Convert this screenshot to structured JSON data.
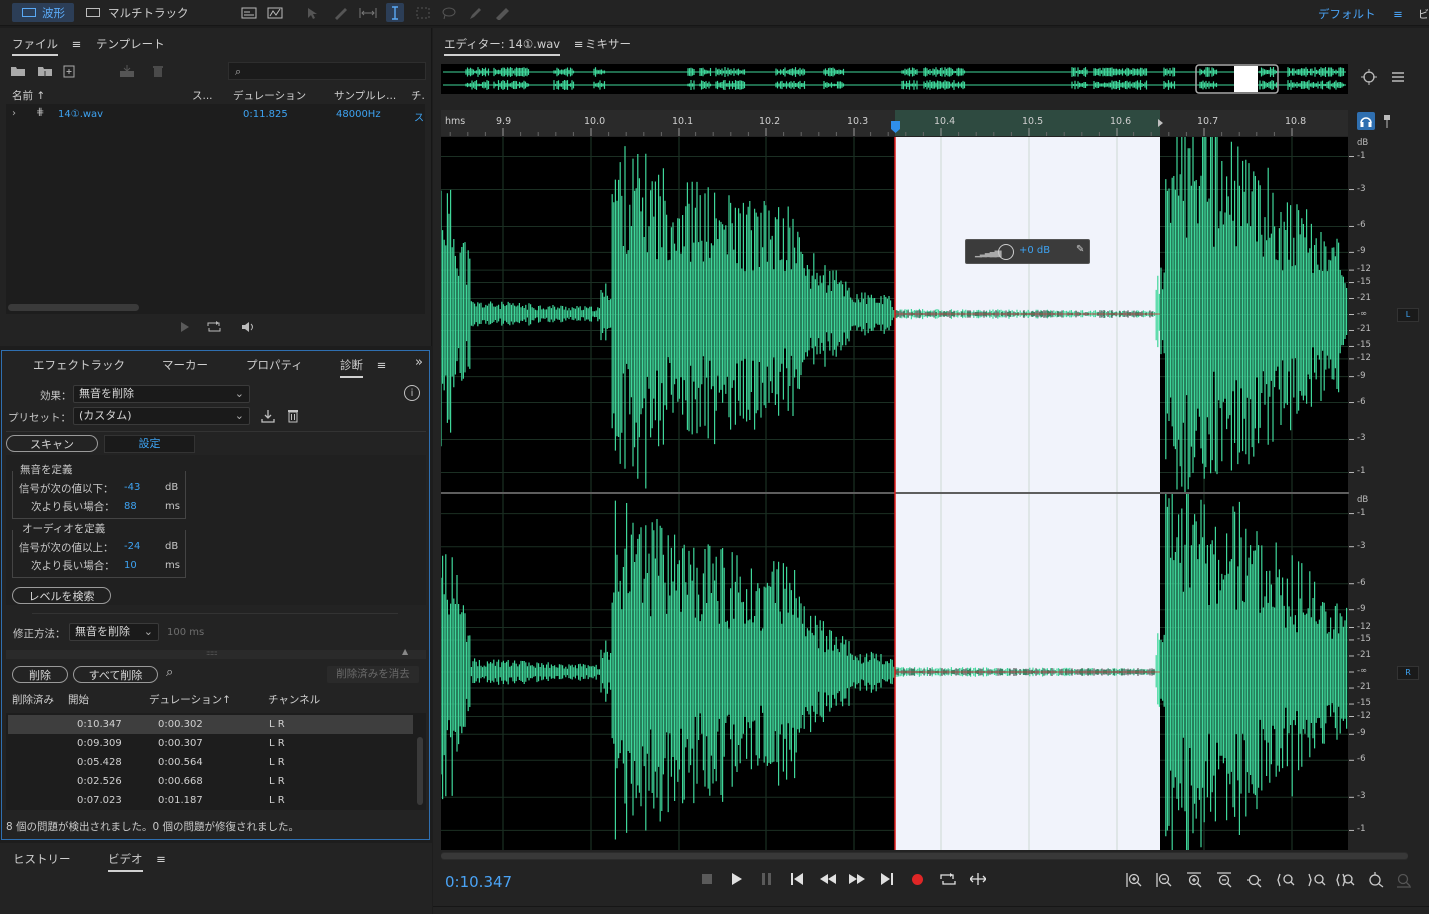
{
  "topbar": {
    "waveform_label": "波形",
    "multitrack_label": "マルチトラック",
    "workspace": "デフォルト",
    "workspace_menu": "≡",
    "edge_label": "ビ"
  },
  "files_panel": {
    "tab_files": "ファイル",
    "tab_template": "テンプレート",
    "menu": "≡",
    "columns": [
      "名前",
      "ス...",
      "デュレーション",
      "サンプルレ...",
      "チ."
    ],
    "file": {
      "name": "14①.wav",
      "duration": "0:11.825",
      "sample_rate": "48000Hz",
      "channels": "ス"
    }
  },
  "diag_panel": {
    "tabs": [
      "エフェクトラック",
      "マーカー",
      "プロパティ",
      "診断"
    ],
    "menu": "≡",
    "overflow": "»",
    "effect_label": "効果：",
    "effect_value": "無音を削除",
    "preset_label": "プリセット：",
    "preset_value": "(カスタム)",
    "scan_button": "スキャン",
    "settings_tab": "設定",
    "silence_header": "無音を定義",
    "silence_signal_label": "信号が次の値以下：",
    "silence_signal_value": "-43",
    "silence_signal_unit": "dB",
    "silence_longer_label": "次より長い場合：",
    "silence_longer_value": "88",
    "silence_longer_unit": "ms",
    "audio_header": "オーディオを定義",
    "audio_signal_label": "信号が次の値以上：",
    "audio_signal_value": "-24",
    "audio_signal_unit": "dB",
    "audio_longer_label": "次より長い場合：",
    "audio_longer_value": "10",
    "audio_longer_unit": "ms",
    "find_levels_button": "レベルを検索",
    "fix_label": "修正方法：",
    "fix_value": "無音を削除",
    "fix_ms": "100 ms",
    "delete_button": "削除",
    "delete_all_button": "すべて削除",
    "clear_deleted_button": "削除済みを消去",
    "columns": [
      "削除済み",
      "開始",
      "デュレーション",
      "チャンネル"
    ],
    "rows": [
      {
        "start": "0:10.347",
        "duration": "0:00.302",
        "channel": "L R"
      },
      {
        "start": "0:09.309",
        "duration": "0:00.307",
        "channel": "L R"
      },
      {
        "start": "0:05.428",
        "duration": "0:00.564",
        "channel": "L R"
      },
      {
        "start": "0:02.526",
        "duration": "0:00.668",
        "channel": "L R"
      },
      {
        "start": "0:07.023",
        "duration": "0:01.187",
        "channel": "L R"
      }
    ],
    "status": "8 個の問題が検出されました。0 個の問題が修復されました。"
  },
  "bottom_panel": {
    "tab_history": "ヒストリー",
    "tab_video": "ビデオ",
    "menu": "≡"
  },
  "editor": {
    "tab_editor": "エディター: 14①.wav",
    "menu": "≡",
    "tab_mixer": "ミキサー",
    "ruler_unit": "hms",
    "ruler_ticks": [
      "9.9",
      "10.0",
      "10.1",
      "10.2",
      "10.3",
      "10.4",
      "10.5",
      "10.6",
      "10.7",
      "10.8"
    ],
    "gain_hud": "+0 dB",
    "db_scale_top": [
      "dB",
      "-1",
      "-3",
      "-6",
      "-9",
      "-12",
      "-15",
      "-21",
      "-∞",
      "-21",
      "-15",
      "-12",
      "-9",
      "-6",
      "-3",
      "-1"
    ],
    "db_scale_bottom": [
      "dB",
      "-1",
      "-3",
      "-6",
      "-9",
      "-12",
      "-15",
      "-21",
      "-∞",
      "-21",
      "-15",
      "-12",
      "-9",
      "-6",
      "-3",
      "-1"
    ],
    "channel_left": "L",
    "channel_right": "R",
    "time_display": "0:10.347",
    "waveform_color": "#3fd69a",
    "accent": "#2f8fea"
  }
}
